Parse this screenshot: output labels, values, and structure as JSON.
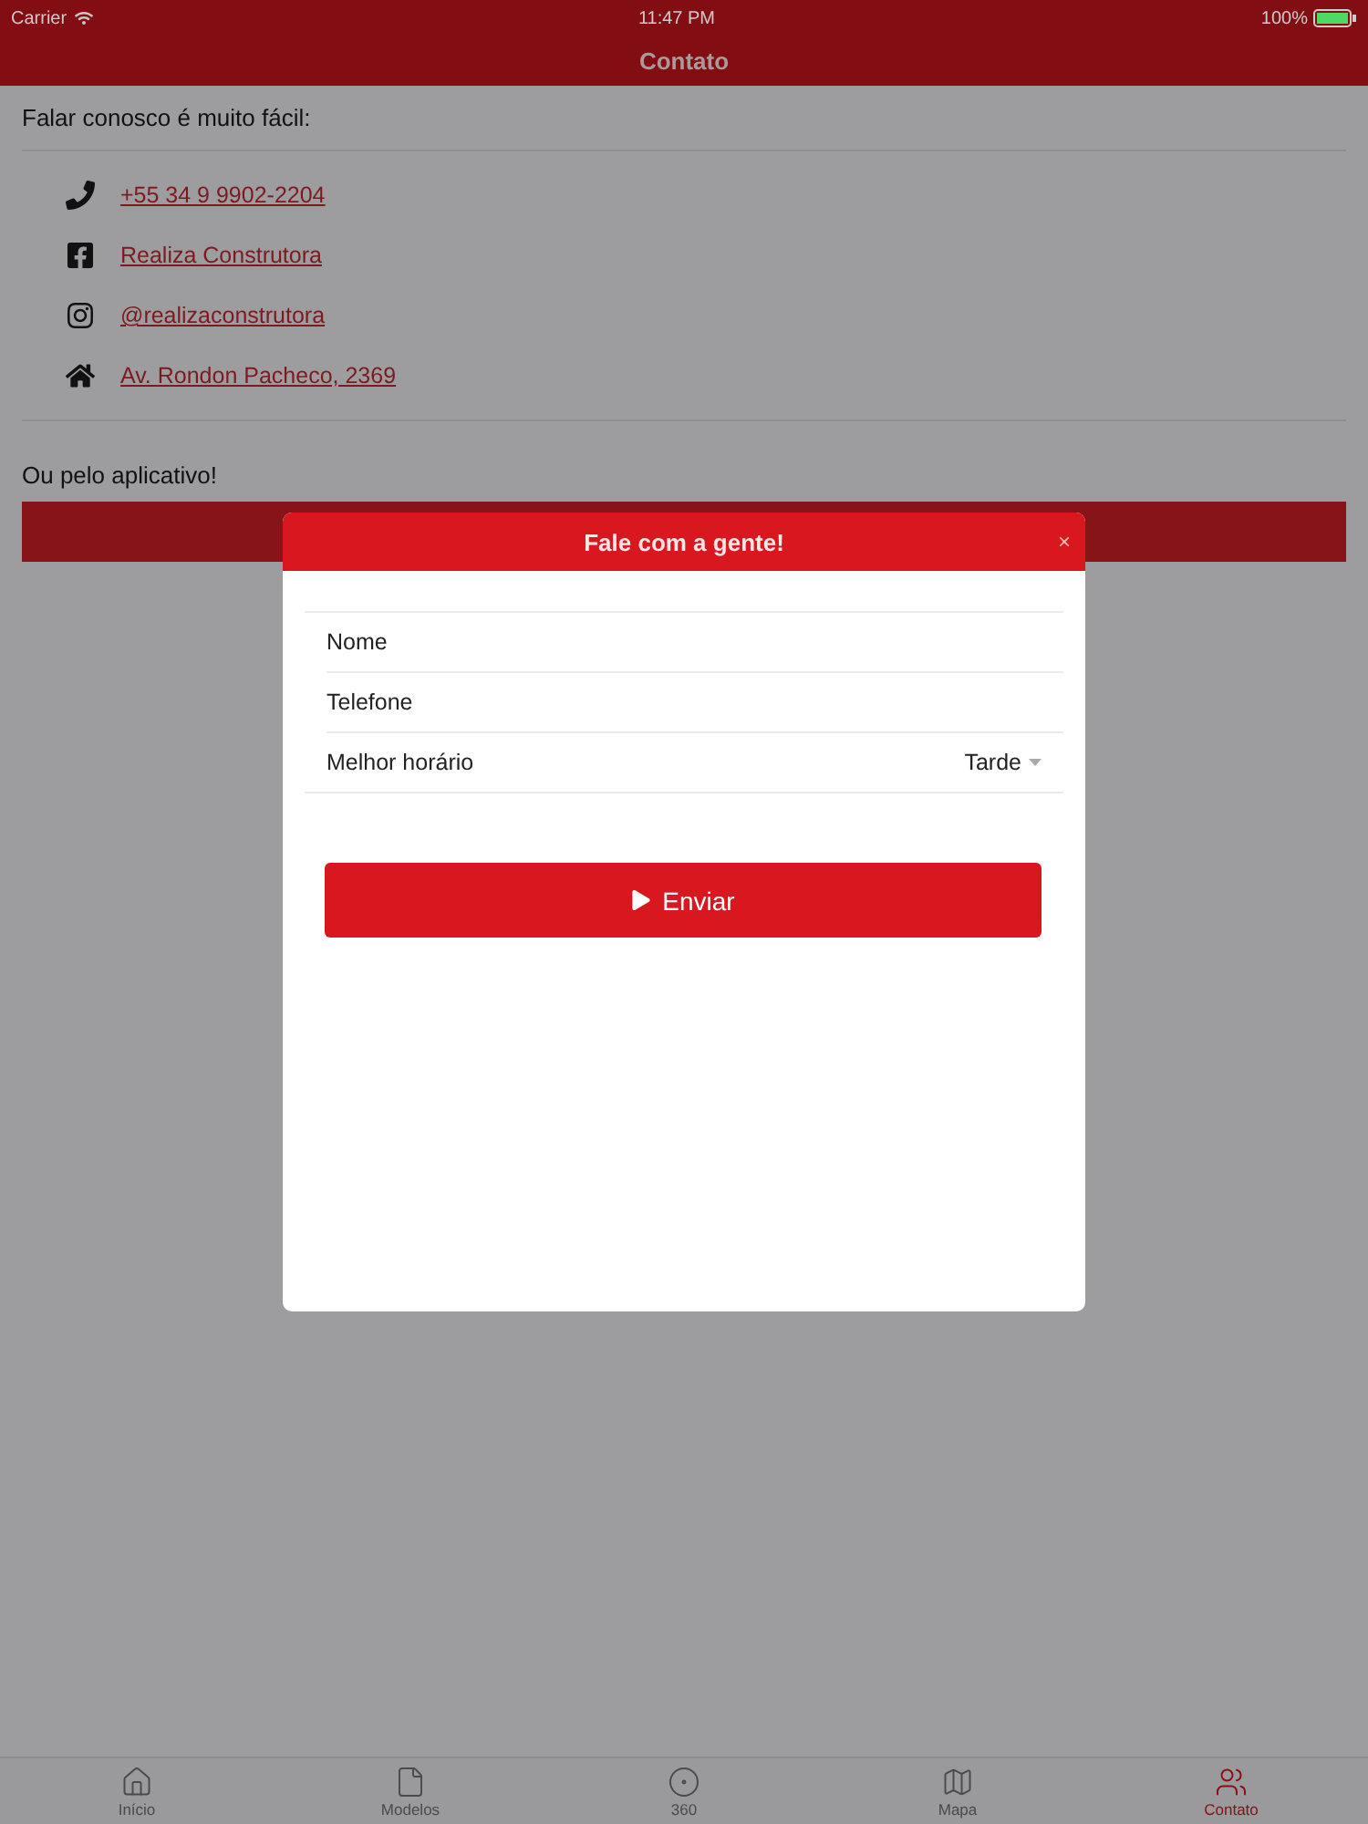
{
  "status_bar": {
    "carrier": "Carrier",
    "time": "11:47 PM",
    "battery": "100%"
  },
  "nav": {
    "title": "Contato"
  },
  "contact": {
    "heading": "Falar conosco é muito fácil:",
    "links": [
      {
        "kind": "phone",
        "text": "+55 34 9 9902-2204"
      },
      {
        "kind": "facebook",
        "text": "Realiza Construtora"
      },
      {
        "kind": "instagram",
        "text": "@realizaconstrutora"
      },
      {
        "kind": "address",
        "text": "Av. Rondon Pacheco, 2369"
      }
    ],
    "app_heading": "Ou pelo aplicativo!"
  },
  "modal": {
    "title": "Fale com a gente!",
    "close": "×",
    "fields": [
      {
        "kind": "input",
        "placeholder": "Nome"
      },
      {
        "kind": "input",
        "placeholder": "Telefone"
      },
      {
        "kind": "select",
        "label": "Melhor horário",
        "value": "Tarde"
      }
    ],
    "submit": "Enviar"
  },
  "tabs": [
    {
      "kind": "home",
      "label": "Início",
      "selected": false
    },
    {
      "kind": "file",
      "label": "Modelos",
      "selected": false
    },
    {
      "kind": "target",
      "label": "360",
      "selected": false
    },
    {
      "kind": "map",
      "label": "Mapa",
      "selected": false
    },
    {
      "kind": "people",
      "label": "Contato",
      "selected": true
    }
  ]
}
